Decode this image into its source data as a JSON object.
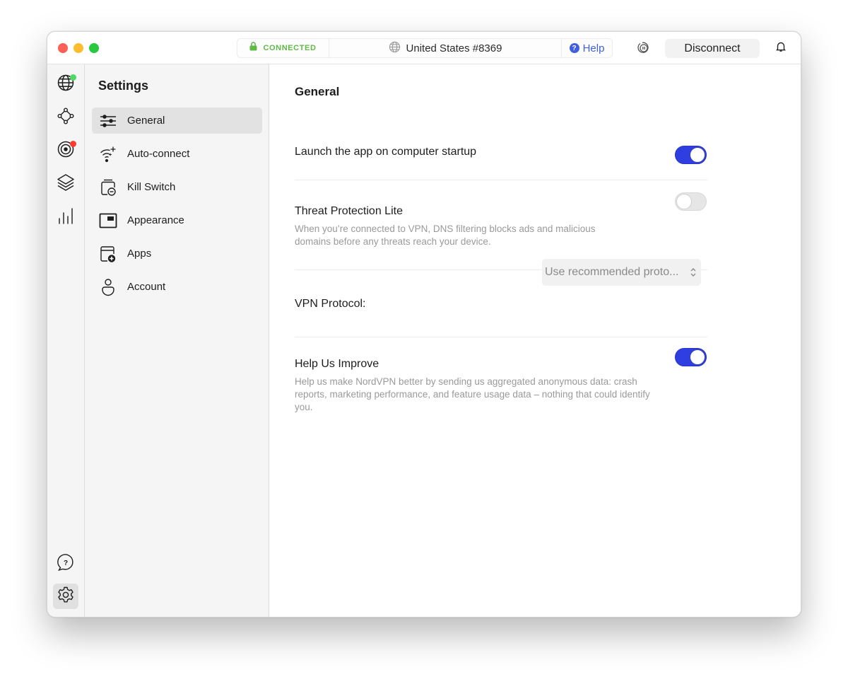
{
  "titlebar": {
    "status": {
      "label": "CONNECTED",
      "color": "#5fba46",
      "icon": "lock-icon"
    },
    "server": {
      "label": "United States #8369",
      "icon": "globe-icon"
    },
    "help": {
      "label": "Help",
      "icon_glyph": "?",
      "color": "#3e5fe0"
    },
    "pause_icon": "pause-shield-icon",
    "disconnect_label": "Disconnect",
    "notifications_icon": "bell-icon"
  },
  "rail": {
    "items": [
      {
        "name": "globe-icon",
        "badge": "#4cd964"
      },
      {
        "name": "meshnet-icon"
      },
      {
        "name": "threat-protection-icon",
        "badge": "#ff3b30"
      },
      {
        "name": "layers-icon"
      },
      {
        "name": "stats-icon"
      }
    ],
    "bottom": [
      {
        "name": "support-icon"
      },
      {
        "name": "settings-gear-icon",
        "active": true
      }
    ]
  },
  "sidebar": {
    "title": "Settings",
    "items": [
      {
        "label": "General",
        "icon": "sliders-icon",
        "active": true
      },
      {
        "label": "Auto-connect",
        "icon": "wifi-sparkle-icon"
      },
      {
        "label": "Kill Switch",
        "icon": "kill-switch-icon"
      },
      {
        "label": "Appearance",
        "icon": "appearance-icon"
      },
      {
        "label": "Apps",
        "icon": "apps-add-icon"
      },
      {
        "label": "Account",
        "icon": "account-icon"
      }
    ]
  },
  "main": {
    "section_title": "General",
    "launch_startup": {
      "title": "Launch the app on computer startup",
      "enabled": true
    },
    "threat_protection": {
      "title": "Threat Protection Lite",
      "description": "When you’re connected to VPN, DNS filtering blocks ads and malicious domains before any threats reach your device.",
      "enabled": false
    },
    "vpn_protocol": {
      "label": "VPN Protocol:",
      "value": "Use recommended proto..."
    },
    "help_improve": {
      "title": "Help Us Improve",
      "description": "Help us make NordVPN better by sending us aggregated anonymous data: crash reports, marketing performance, and feature usage data – nothing that could identify you.",
      "enabled": true
    }
  },
  "colors": {
    "accent": "#2f3ee0",
    "connected": "#5fba46",
    "help": "#3e5fe0"
  }
}
